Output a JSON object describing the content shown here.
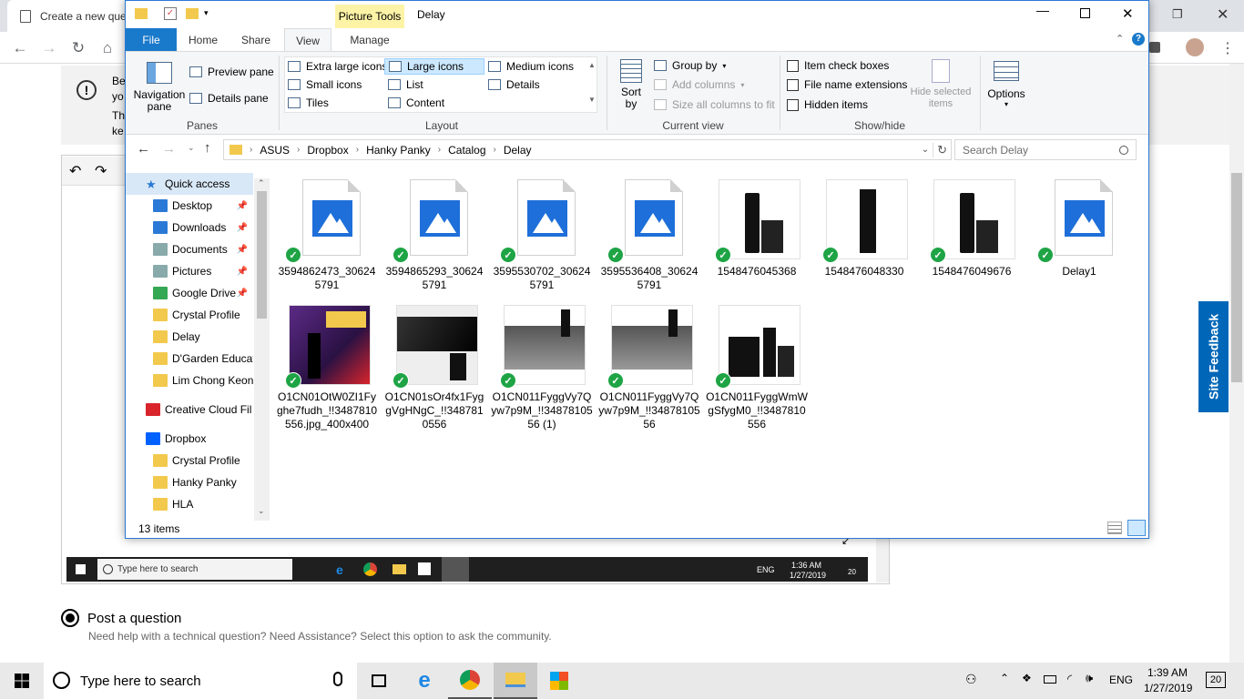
{
  "browser": {
    "tab_title": "Create a new que",
    "notice_snippets": [
      "Be",
      "yo",
      "Th",
      "ke"
    ]
  },
  "page": {
    "post_question_label": "Post a question",
    "post_question_desc": "Need help with a technical question? Need Assistance? Select this option to ask the community.",
    "site_feedback_label": "Site Feedback"
  },
  "inner_taskbar": {
    "search_placeholder": "Type here to search",
    "time": "1:36 AM",
    "date": "1/27/2019",
    "lang": "ENG",
    "notif_count": "20"
  },
  "explorer": {
    "window_title": "Delay",
    "picture_tools_label": "Picture Tools",
    "ribbon_tabs": [
      "File",
      "Home",
      "Share",
      "View",
      "Manage"
    ],
    "panes": {
      "navigation_pane": "Navigation pane",
      "preview_pane": "Preview pane",
      "details_pane": "Details pane",
      "group_label": "Panes"
    },
    "layout": {
      "options": [
        "Extra large icons",
        "Large icons",
        "Medium icons",
        "Small icons",
        "List",
        "Details",
        "Tiles",
        "Content"
      ],
      "selected": "Large icons",
      "group_label": "Layout"
    },
    "current_view": {
      "sort_by": "Sort by",
      "group_by": "Group by",
      "add_columns": "Add columns",
      "size_columns": "Size all columns to fit",
      "group_label": "Current view"
    },
    "show_hide": {
      "item_check_boxes": "Item check boxes",
      "file_name_extensions": "File name extensions",
      "hidden_items": "Hidden items",
      "hide_selected_items": "Hide selected items",
      "group_label": "Show/hide"
    },
    "options_label": "Options",
    "breadcrumb": [
      "ASUS",
      "Dropbox",
      "Hanky Panky",
      "Catalog",
      "Delay"
    ],
    "search_placeholder": "Search Delay",
    "nav_items": [
      {
        "label": "Quick access",
        "icon": "star-icon"
      },
      {
        "label": "Desktop",
        "icon": "desktop-icon",
        "pinned": true
      },
      {
        "label": "Downloads",
        "icon": "download-icon",
        "pinned": true
      },
      {
        "label": "Documents",
        "icon": "documents-icon",
        "pinned": true
      },
      {
        "label": "Pictures",
        "icon": "pictures-icon",
        "pinned": true
      },
      {
        "label": "Google Drive",
        "icon": "google-drive-icon",
        "pinned": true
      },
      {
        "label": "Crystal Profile",
        "icon": "folder-icon"
      },
      {
        "label": "Delay",
        "icon": "folder-icon"
      },
      {
        "label": "D'Garden Educat",
        "icon": "folder-icon"
      },
      {
        "label": "Lim Chong Keon",
        "icon": "folder-icon"
      },
      {
        "label": "Creative Cloud Fil",
        "icon": "creative-cloud-icon"
      },
      {
        "label": "Dropbox",
        "icon": "dropbox-icon"
      },
      {
        "label": "Crystal Profile",
        "icon": "folder-icon"
      },
      {
        "label": "Hanky Panky",
        "icon": "shared-folder-icon"
      },
      {
        "label": "HLA",
        "icon": "folder-icon"
      }
    ],
    "files": [
      {
        "name": "3594862473_306245791",
        "kind": "generic"
      },
      {
        "name": "3594865293_306245791",
        "kind": "generic"
      },
      {
        "name": "3595530702_306245791",
        "kind": "generic"
      },
      {
        "name": "3595536408_306245791",
        "kind": "generic"
      },
      {
        "name": "1548476045368",
        "kind": "product"
      },
      {
        "name": "1548476048330",
        "kind": "product-single"
      },
      {
        "name": "1548476049676",
        "kind": "product"
      },
      {
        "name": "Delay1",
        "kind": "generic"
      },
      {
        "name": "O1CN01OtW0ZI1Fyghe7fudh_!!3487810556.jpg_400x400",
        "kind": "poster"
      },
      {
        "name": "O1CN01sOr4fx1FyggVgHNgC_!!3487810556",
        "kind": "dark"
      },
      {
        "name": "O1CN011FyggVy7Qyw7p9M_!!3487810556 (1)",
        "kind": "sheet"
      },
      {
        "name": "O1CN011FyggVy7Qyw7p9M_!!3487810556",
        "kind": "sheet"
      },
      {
        "name": "O1CN011FyggWmWgSfygM0_!!3487810556",
        "kind": "display"
      }
    ],
    "status_count": "13 items"
  },
  "taskbar": {
    "search_placeholder": "Type here to search",
    "time": "1:39 AM",
    "date": "1/27/2019",
    "lang": "ENG",
    "notif_count": "20"
  }
}
